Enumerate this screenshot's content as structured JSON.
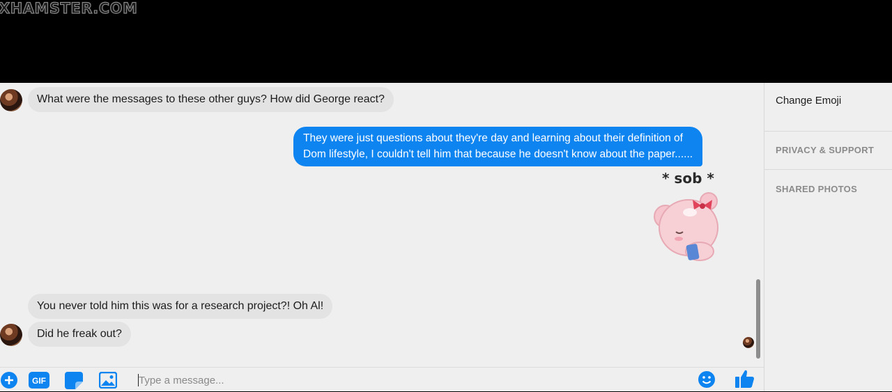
{
  "watermark": "XHAMSTER.COM",
  "conversation": {
    "messages": [
      {
        "from": "other",
        "text": "What were the messages to these other guys? How did George react?"
      },
      {
        "from": "me",
        "text": "They were just questions about they're day and learning about their definition of\nDom lifestyle, I couldn't tell him that because he doesn't know about the paper......"
      },
      {
        "from": "me",
        "sticker_text": "* sob *"
      },
      {
        "from": "other",
        "text": "You never told him this was for a research project?! Oh Al!"
      },
      {
        "from": "other",
        "text": "Did he freak out?"
      }
    ]
  },
  "sidebar": {
    "change_emoji": "Change Emoji",
    "privacy_support": "PRIVACY & SUPPORT",
    "shared_photos": "SHARED PHOTOS"
  },
  "composer": {
    "placeholder": "Type a message...",
    "tools": [
      "plus-icon",
      "gif-icon",
      "sticker-icon",
      "image-icon"
    ],
    "gif_label": "GIF",
    "right_icons": [
      "emoji-icon",
      "thumbs-up-icon"
    ]
  },
  "colors": {
    "accent": "#0e84f0",
    "incoming_bubble": "#e3e3e3",
    "background": "#efefef"
  }
}
